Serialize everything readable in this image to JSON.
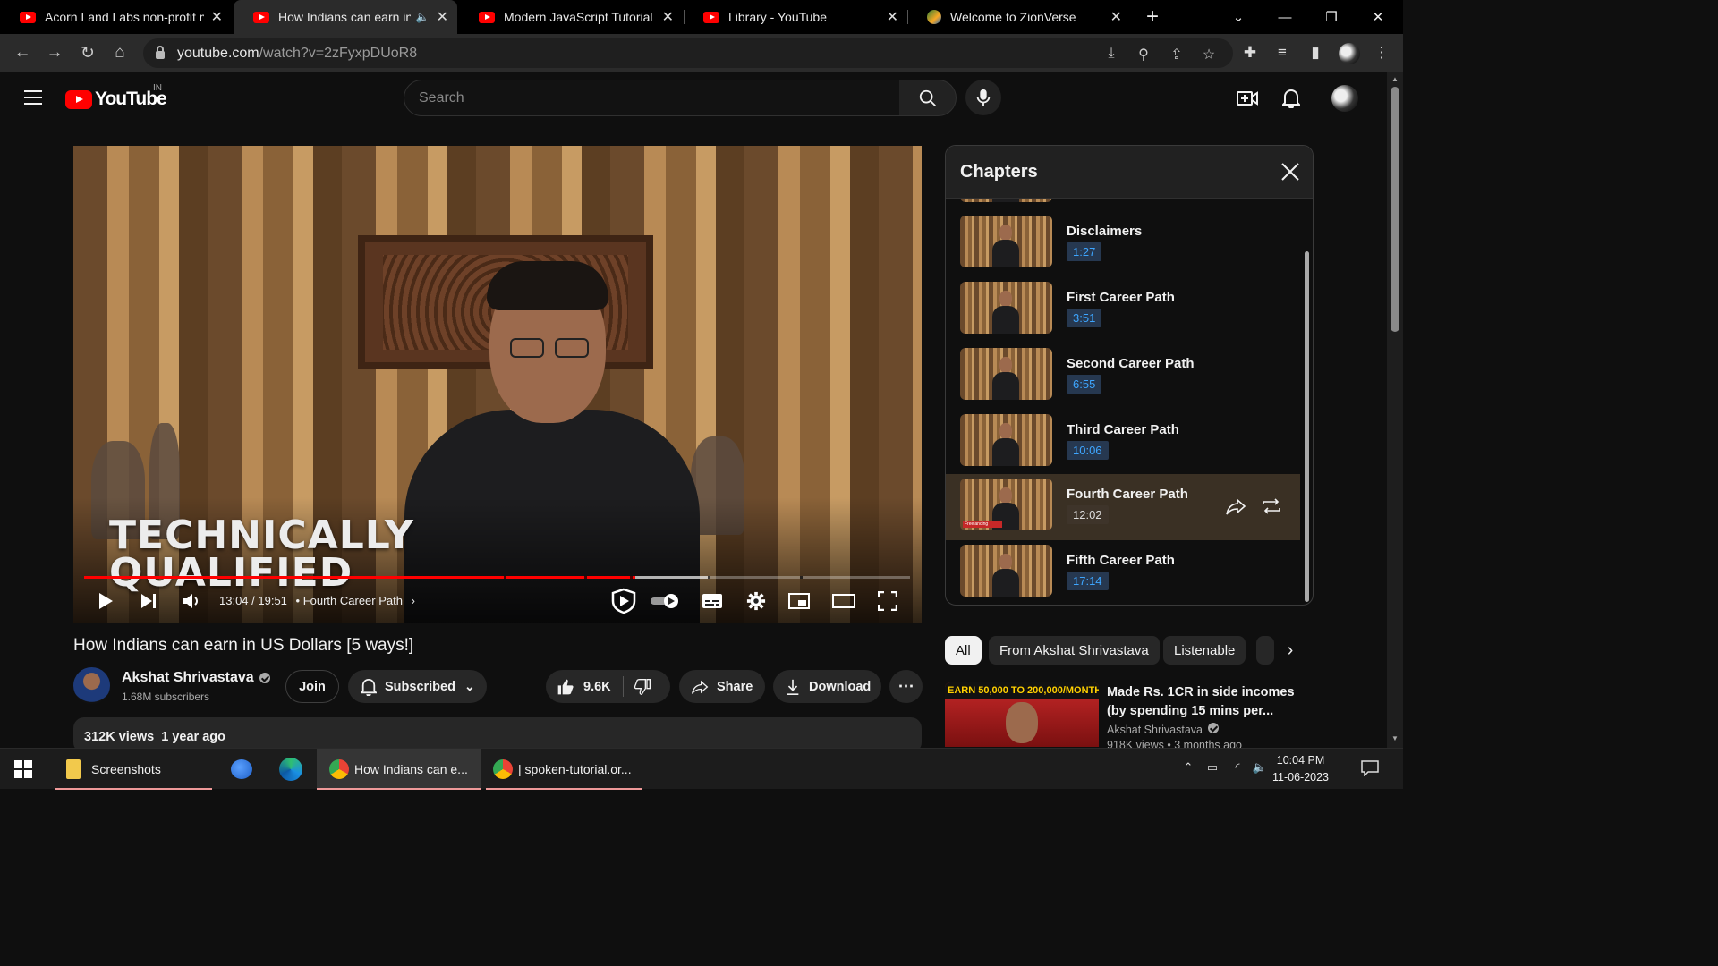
{
  "colors": {
    "accent_red": "#ff0000",
    "chapter_time_blue": "#3ea6ff",
    "bg": "#0f0f0f"
  },
  "browser": {
    "tabs": [
      {
        "title": "Acorn Land Labs non-profit m",
        "icon": "youtube-favicon"
      },
      {
        "title": "How Indians can earn in U",
        "icon": "youtube-favicon"
      },
      {
        "title": "Modern JavaScript Tutorial #",
        "icon": "youtube-favicon"
      },
      {
        "title": "Library - YouTube",
        "icon": "youtube-favicon"
      },
      {
        "title": "Welcome to ZionVerse",
        "icon": "zionverse-favicon"
      }
    ],
    "url_host": "youtube.com",
    "url_path": "/watch?v=2zFyxpDUoR8"
  },
  "youtube": {
    "country_code": "IN",
    "search_placeholder": "Search",
    "logo_text": "YouTube"
  },
  "player": {
    "overlay_line1": "TECHNICALLY",
    "overlay_line2": "QUALIFIED",
    "time": "13:04 / 19:51",
    "chapter_label": "• Fourth Career Path",
    "progress_fraction": 0.667
  },
  "chapters": {
    "title": "Chapters",
    "items": [
      {
        "title": "Disclaimers",
        "time": "1:27"
      },
      {
        "title": "First Career Path",
        "time": "3:51"
      },
      {
        "title": "Second Career Path",
        "time": "6:55"
      },
      {
        "title": "Third Career Path",
        "time": "10:06"
      },
      {
        "title": "Fourth Career Path",
        "time": "12:02",
        "active": true
      },
      {
        "title": "Fifth Career Path",
        "time": "17:14"
      }
    ],
    "thumb_tag": "Freelancing"
  },
  "chips": [
    "All",
    "From Akshat Shrivastava",
    "Listenable"
  ],
  "recommended": {
    "banner": "EARN 50,000 TO 200,000/MONTH!",
    "title": "Made Rs. 1CR in side incomes (by spending 15 mins per...",
    "channel": "Akshat Shrivastava",
    "meta": "918K views • 3 months ago"
  },
  "video": {
    "title": "How Indians can earn in US Dollars [5 ways!]",
    "channel": "Akshat Shrivastava",
    "subscribers": "1.68M subscribers",
    "join": "Join",
    "subscribed": "Subscribed",
    "likes": "9.6K",
    "share": "Share",
    "download": "Download",
    "views": "312K views",
    "age": "1 year ago"
  },
  "taskbar": {
    "items": [
      {
        "label": "Screenshots"
      },
      {
        "label": "How Indians can e..."
      },
      {
        "label": "| spoken-tutorial.or..."
      }
    ],
    "time": "10:04 PM",
    "date": "11-06-2023"
  }
}
